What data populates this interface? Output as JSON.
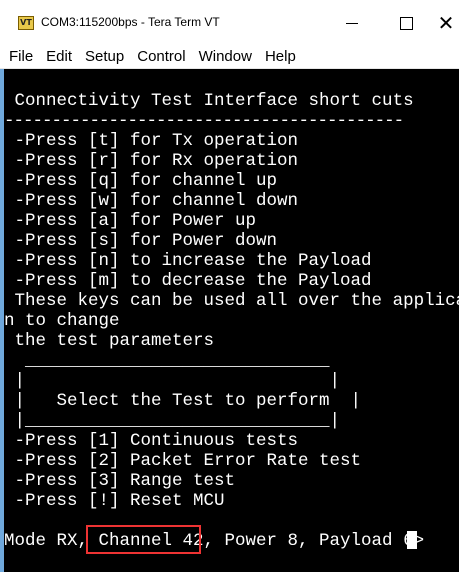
{
  "window": {
    "title": "COM3:115200bps - Tera Term VT",
    "icon_label": "VT"
  },
  "menu": [
    "File",
    "Edit",
    "Setup",
    "Control",
    "Window",
    "Help"
  ],
  "terminal": {
    "lines": [
      " Connectivity Test Interface short cuts",
      "------------------------------------------",
      " -Press [t] for Tx operation",
      " -Press [r] for Rx operation",
      " -Press [q] for channel up",
      " -Press [w] for channel down",
      " -Press [a] for Power up",
      " -Press [s] for Power down",
      " -Press [n] to increase the Payload",
      " -Press [m] to decrease the Payload",
      " These keys can be used all over the applicatio",
      "n to change",
      " the test parameters",
      "  _____________________________",
      " |                             |",
      " |   Select the Test to perform  |",
      " |_____________________________|",
      " -Press [1] Continuous tests",
      " -Press [2] Packet Error Rate test",
      " -Press [3] Range test",
      " -Press [!] Reset MCU",
      "",
      "Mode RX, Channel 42, Power 8, Payload 6>"
    ]
  }
}
